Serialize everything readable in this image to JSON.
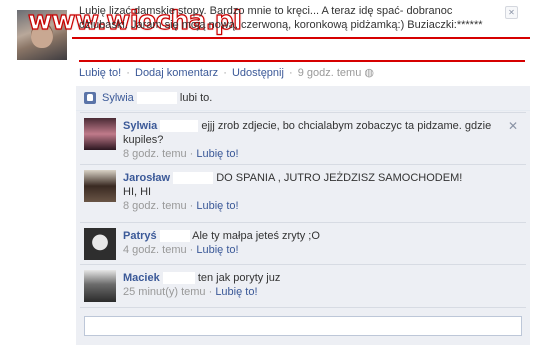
{
  "watermark": "www.wiocha.pl",
  "post": {
    "line1": "Lubię lizać damskie stopy. Bardzo mnie to kręci... A teraz idę spać- dobranoc",
    "line2": "dziubaski. Jaram się moją nową, czerwoną, koronkową pidżamką:) Buziaczki:******"
  },
  "actions": {
    "like": "Lubię to!",
    "comment": "Dodaj komentarz",
    "share": "Udostępnij",
    "time": "9 godz. temu"
  },
  "like_row": {
    "name": "Sylwia",
    "text": "lubi to."
  },
  "comments": [
    {
      "name": "Sylwia",
      "text": "ejjj zrob zdjecie, bo chcialabym zobaczyc ta pidzame. gdzie kupiles?",
      "time": "8 godz. temu",
      "like": "Lubię to!"
    },
    {
      "name": "Jarosław",
      "text": "DO SPANIA , JUTRO JEŻDZISZ SAMOCHODEM!",
      "text2": "HI, HI",
      "time": "8 godz. temu",
      "like": "Lubię to!"
    },
    {
      "name": "Patryś",
      "text": "Ale ty małpa jeteś zryty ;O",
      "time": "4 godz. temu",
      "like": "Lubię to!"
    },
    {
      "name": "Maciek",
      "text": "ten jak poryty juz",
      "time": "25 minut(y) temu",
      "like": "Lubię to!"
    }
  ],
  "colors": {
    "link": "#3b5998",
    "feedback_bg": "#edeff4",
    "watermark": "#c80000",
    "underline": "#d60000"
  },
  "icons": {
    "close": "close-icon",
    "like": "thumbs-up-icon",
    "public": "globe-icon"
  }
}
